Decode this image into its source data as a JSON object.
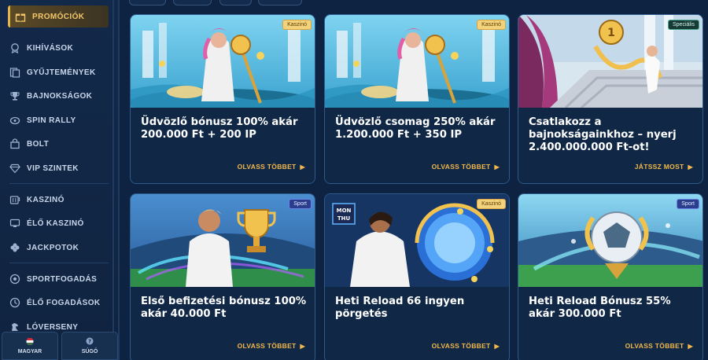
{
  "sidebar": {
    "items": [
      {
        "label": "PROMÓCIÓK",
        "icon": "gift-icon"
      },
      {
        "label": "KIHÍVÁSOK",
        "icon": "medal-icon"
      },
      {
        "label": "GYŰJTEMÉNYEK",
        "icon": "collection-icon"
      },
      {
        "label": "BAJNOKSÁGOK",
        "icon": "trophy-icon"
      },
      {
        "label": "SPIN RALLY",
        "icon": "rally-icon"
      },
      {
        "label": "BOLT",
        "icon": "shop-icon"
      },
      {
        "label": "VIP SZINTEK",
        "icon": "diamond-icon"
      },
      {
        "label": "KASZINÓ",
        "icon": "slot-icon"
      },
      {
        "label": "ÉLŐ KASZINÓ",
        "icon": "live-casino-icon"
      },
      {
        "label": "JACKPOTOK",
        "icon": "clover-icon"
      },
      {
        "label": "SPORTFOGADÁS",
        "icon": "ball-icon"
      },
      {
        "label": "ÉLŐ FOGADÁSOK",
        "icon": "live-betting-icon"
      },
      {
        "label": "LÓVERSENY",
        "icon": "horse-icon"
      }
    ],
    "language_label": "MAGYAR",
    "help_label": "SÚGÓ"
  },
  "cards": [
    {
      "badge": "Kaszinó",
      "title": "Üdvözlő bónusz 100% akár 200.000 Ft + 200 IP",
      "cta": "OLVASS TÖBBET"
    },
    {
      "badge": "Kaszinó",
      "title": "Üdvözlő csomag 250% akár 1.200.000 Ft + 350 IP",
      "cta": "OLVASS TÖBBET"
    },
    {
      "badge": "Speciális",
      "title": "Csatlakozz a bajnokságainkhoz – nyerj 2.400.000.000 Ft-ot!",
      "cta": "JÁTSSZ MOST"
    },
    {
      "badge": "Sport",
      "title": "Első befizetési bónusz 100% akár 40.000 Ft",
      "cta": "OLVASS TÖBBET"
    },
    {
      "badge": "Kaszinó",
      "title": "Heti Reload 66 ingyen pörgetés",
      "cta": "OLVASS TÖBBET",
      "art_text": "MON THU"
    },
    {
      "badge": "Sport",
      "title": "Heti Reload Bónusz 55% akár 300.000 Ft",
      "cta": "OLVASS TÖBBET"
    }
  ],
  "colors": {
    "accent": "#f2b84b",
    "background": "#0d2341",
    "card_border": "#2d5b8c"
  }
}
